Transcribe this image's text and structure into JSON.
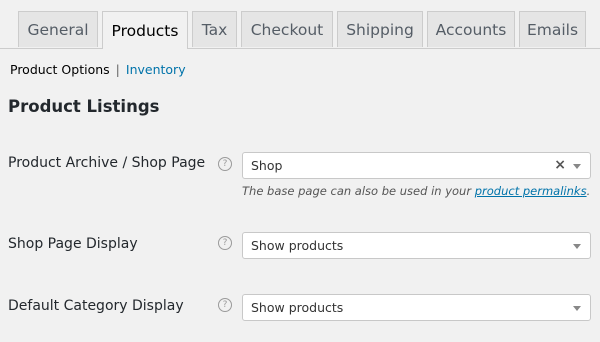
{
  "tabs": [
    {
      "label": "General",
      "active": false
    },
    {
      "label": "Products",
      "active": true
    },
    {
      "label": "Tax",
      "active": false
    },
    {
      "label": "Checkout",
      "active": false
    },
    {
      "label": "Shipping",
      "active": false
    },
    {
      "label": "Accounts",
      "active": false
    },
    {
      "label": "Emails",
      "active": false
    }
  ],
  "subnav": {
    "current": "Product Options",
    "separator": "|",
    "link": "Inventory"
  },
  "section_title": "Product Listings",
  "settings": {
    "shop_page": {
      "label": "Product Archive / Shop Page",
      "value": "Shop",
      "clear": "×",
      "description_prefix": "The base page can also be used in your ",
      "description_link": "product permalinks",
      "description_suffix": "."
    },
    "shop_display": {
      "label": "Shop Page Display",
      "value": "Show products"
    },
    "category_display": {
      "label": "Default Category Display",
      "value": "Show products"
    }
  },
  "help_glyph": "?",
  "colors": {
    "background": "#f1f1f1",
    "link": "#0073aa",
    "tab_inactive": "#e5e5e5"
  }
}
